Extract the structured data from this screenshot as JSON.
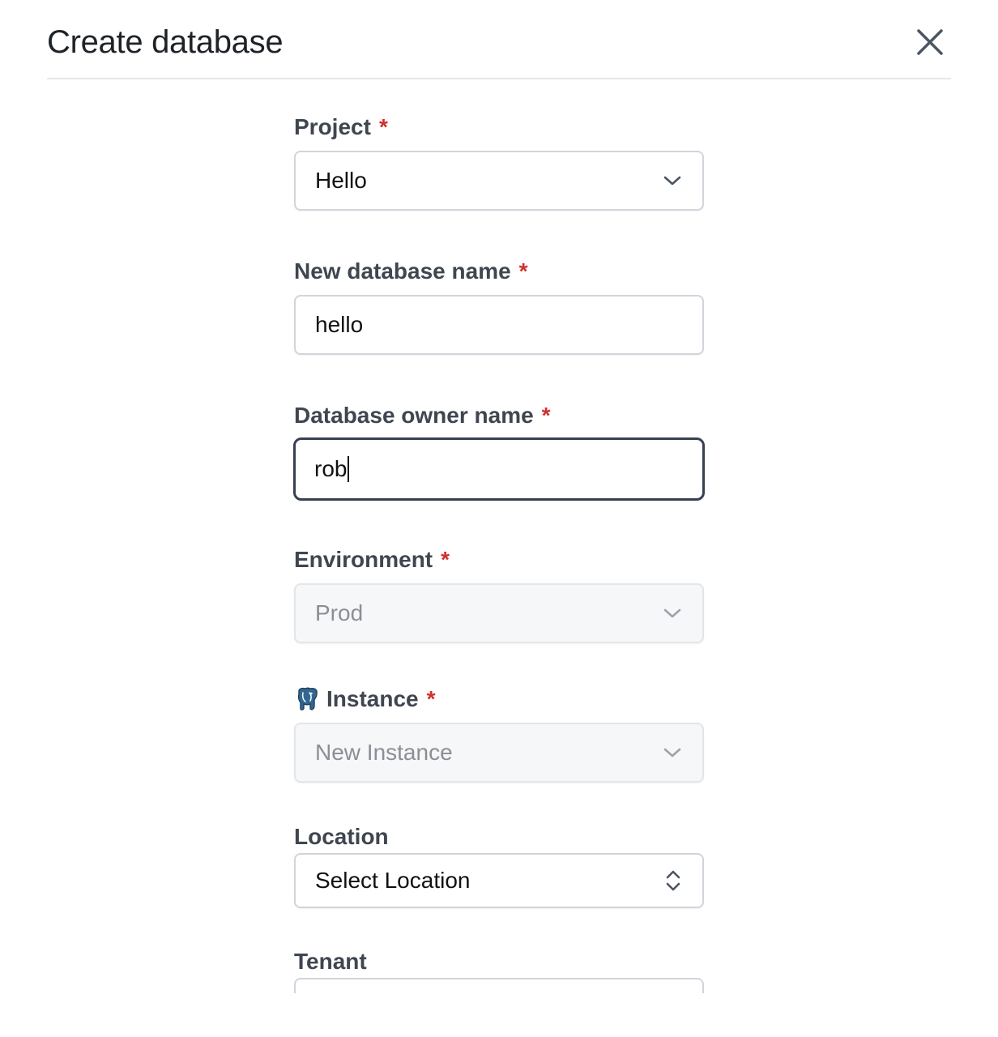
{
  "dialog": {
    "title": "Create database"
  },
  "form": {
    "required_mark": "*",
    "project": {
      "label": "Project",
      "value": "Hello"
    },
    "database_name": {
      "label": "New database name",
      "value": "hello"
    },
    "owner_name": {
      "label": "Database owner name",
      "value": "rob"
    },
    "environment": {
      "label": "Environment",
      "value": "Prod"
    },
    "instance": {
      "label": "Instance",
      "value": "New Instance",
      "icon": "postgresql-elephant-icon"
    },
    "location": {
      "label": "Location",
      "value": "Select Location"
    },
    "tenant": {
      "label": "Tenant"
    }
  },
  "colors": {
    "required": "#d0312d",
    "label": "#3f4650",
    "border": "#d1d5db",
    "focus_border": "#374151",
    "disabled_bg": "#f6f7f8"
  }
}
